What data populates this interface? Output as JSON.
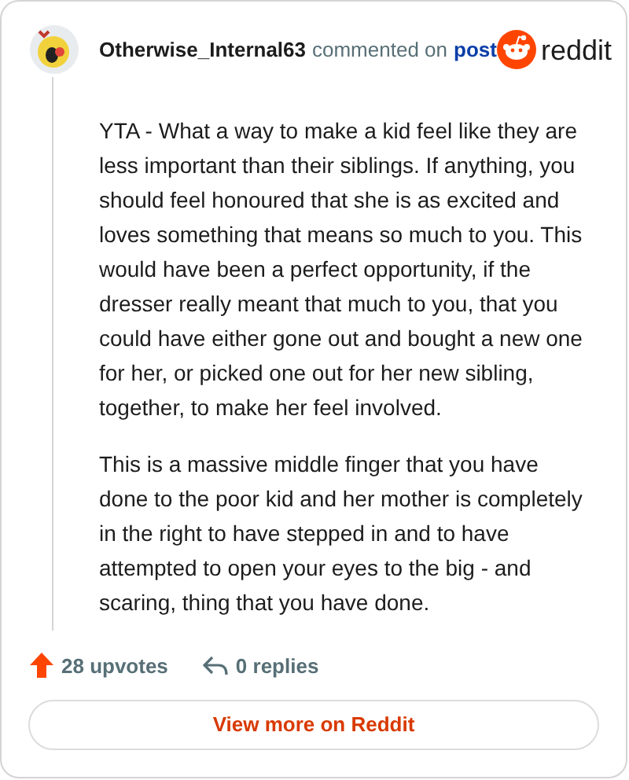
{
  "comment": {
    "author": "Otherwise_Internal63",
    "action": "commented on",
    "link": "post",
    "brand": "reddit",
    "paragraphs": [
      "YTA - What a way to make a kid feel like they are less important than their siblings. If anything, you should feel honoured that she is as excited and loves something that means so much to you. This would have been a perfect opportunity, if the dresser really meant that much to you, that you could have either gone out and bought a new one for her, or picked one out for her new sibling, together, to make her feel involved.",
      "This is a massive middle finger that you have done to the poor kid and her mother is completely in the right to have stepped in and to have attempted to open your eyes to the big - and scaring, thing that you have done."
    ],
    "upvotes": "28 upvotes",
    "replies": "0 replies",
    "button": "View more on Reddit"
  }
}
